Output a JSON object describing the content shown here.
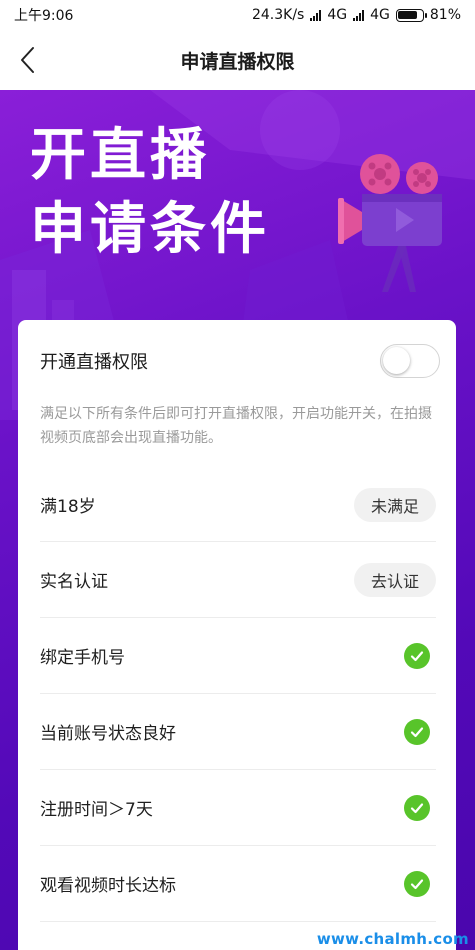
{
  "status_bar": {
    "time": "上午9:06",
    "speed": "24.3K/s",
    "network1": "4G",
    "network2": "4G",
    "battery": "81%",
    "battery_level": 0.81
  },
  "nav": {
    "title": "申请直播权限",
    "back_icon": "chevron-left-icon"
  },
  "hero": {
    "line1": "开直播",
    "line2": "申请条件",
    "illustration_icon": "movie-camera-icon"
  },
  "card": {
    "toggle_label": "开通直播权限",
    "toggle_on": false,
    "description": "满足以下所有条件后即可打开直播权限，开启功能开关，在拍摄视频页底部会出现直播功能。",
    "requirements": [
      {
        "label": "满18岁",
        "status": "未满足"
      },
      {
        "label": "实名认证",
        "status": "去认证"
      },
      {
        "label": "绑定手机号",
        "status": "check"
      },
      {
        "label": "当前账号状态良好",
        "status": "check"
      },
      {
        "label": "注册时间＞7天",
        "status": "check"
      },
      {
        "label": "观看视频时长达标",
        "status": "check"
      }
    ]
  },
  "watermark": "www.chalmh.com",
  "colors": {
    "hero_gradient_start": "#8a1fd8",
    "hero_gradient_end": "#4a06ad",
    "check_green": "#58c42a",
    "watermark_blue": "#1a8ee8",
    "camera_pink": "#e0529a"
  }
}
